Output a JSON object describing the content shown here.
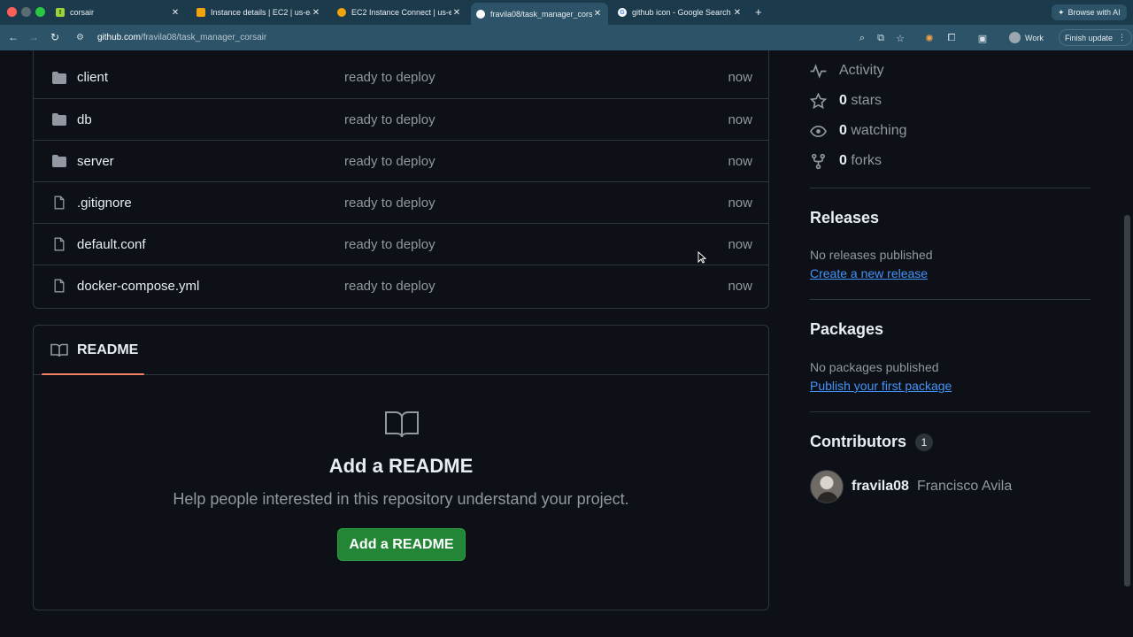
{
  "browser": {
    "tabs": [
      {
        "label": "corsair",
        "favicon_color": "#9bd43a",
        "favicon_glyph": "!"
      },
      {
        "label": "Instance details | EC2 | us-ea",
        "favicon_color": "#f0a30a",
        "favicon_glyph": ""
      },
      {
        "label": "EC2 Instance Connect | us-ea",
        "favicon_color": "#f0a30a",
        "favicon_glyph": ""
      },
      {
        "label": "fravila08/task_manager_cors",
        "favicon_color": "#ffffff",
        "favicon_glyph": ""
      },
      {
        "label": "github icon - Google Search",
        "favicon_color": "#ffffff",
        "favicon_glyph": "G"
      }
    ],
    "new_tab": "+",
    "browse_ai": "Browse with AI",
    "url_host": "github.com",
    "url_path": "/fravila08/task_manager_corsair",
    "profile": "Work",
    "finish_update": "Finish update"
  },
  "files": [
    {
      "name": "client",
      "type": "folder",
      "message": "ready to deploy",
      "age": "now"
    },
    {
      "name": "db",
      "type": "folder",
      "message": "ready to deploy",
      "age": "now"
    },
    {
      "name": "server",
      "type": "folder",
      "message": "ready to deploy",
      "age": "now"
    },
    {
      "name": ".gitignore",
      "type": "file",
      "message": "ready to deploy",
      "age": "now"
    },
    {
      "name": "default.conf",
      "type": "file",
      "message": "ready to deploy",
      "age": "now"
    },
    {
      "name": "docker-compose.yml",
      "type": "file",
      "message": "ready to deploy",
      "age": "now"
    }
  ],
  "readme": {
    "tab": "README",
    "title": "Add a README",
    "subtitle": "Help people interested in this repository understand your project.",
    "button": "Add a README"
  },
  "sidebar": {
    "activity": "Activity",
    "stars_count": "0",
    "stars_label": "stars",
    "watching_count": "0",
    "watching_label": "watching",
    "forks_count": "0",
    "forks_label": "forks",
    "releases_title": "Releases",
    "releases_text": "No releases published",
    "releases_link": "Create a new release",
    "packages_title": "Packages",
    "packages_text": "No packages published",
    "packages_link": "Publish your first package",
    "contributors_title": "Contributors",
    "contributors_count": "1",
    "contributor_login": "fravila08",
    "contributor_name": "Francisco Avila"
  }
}
